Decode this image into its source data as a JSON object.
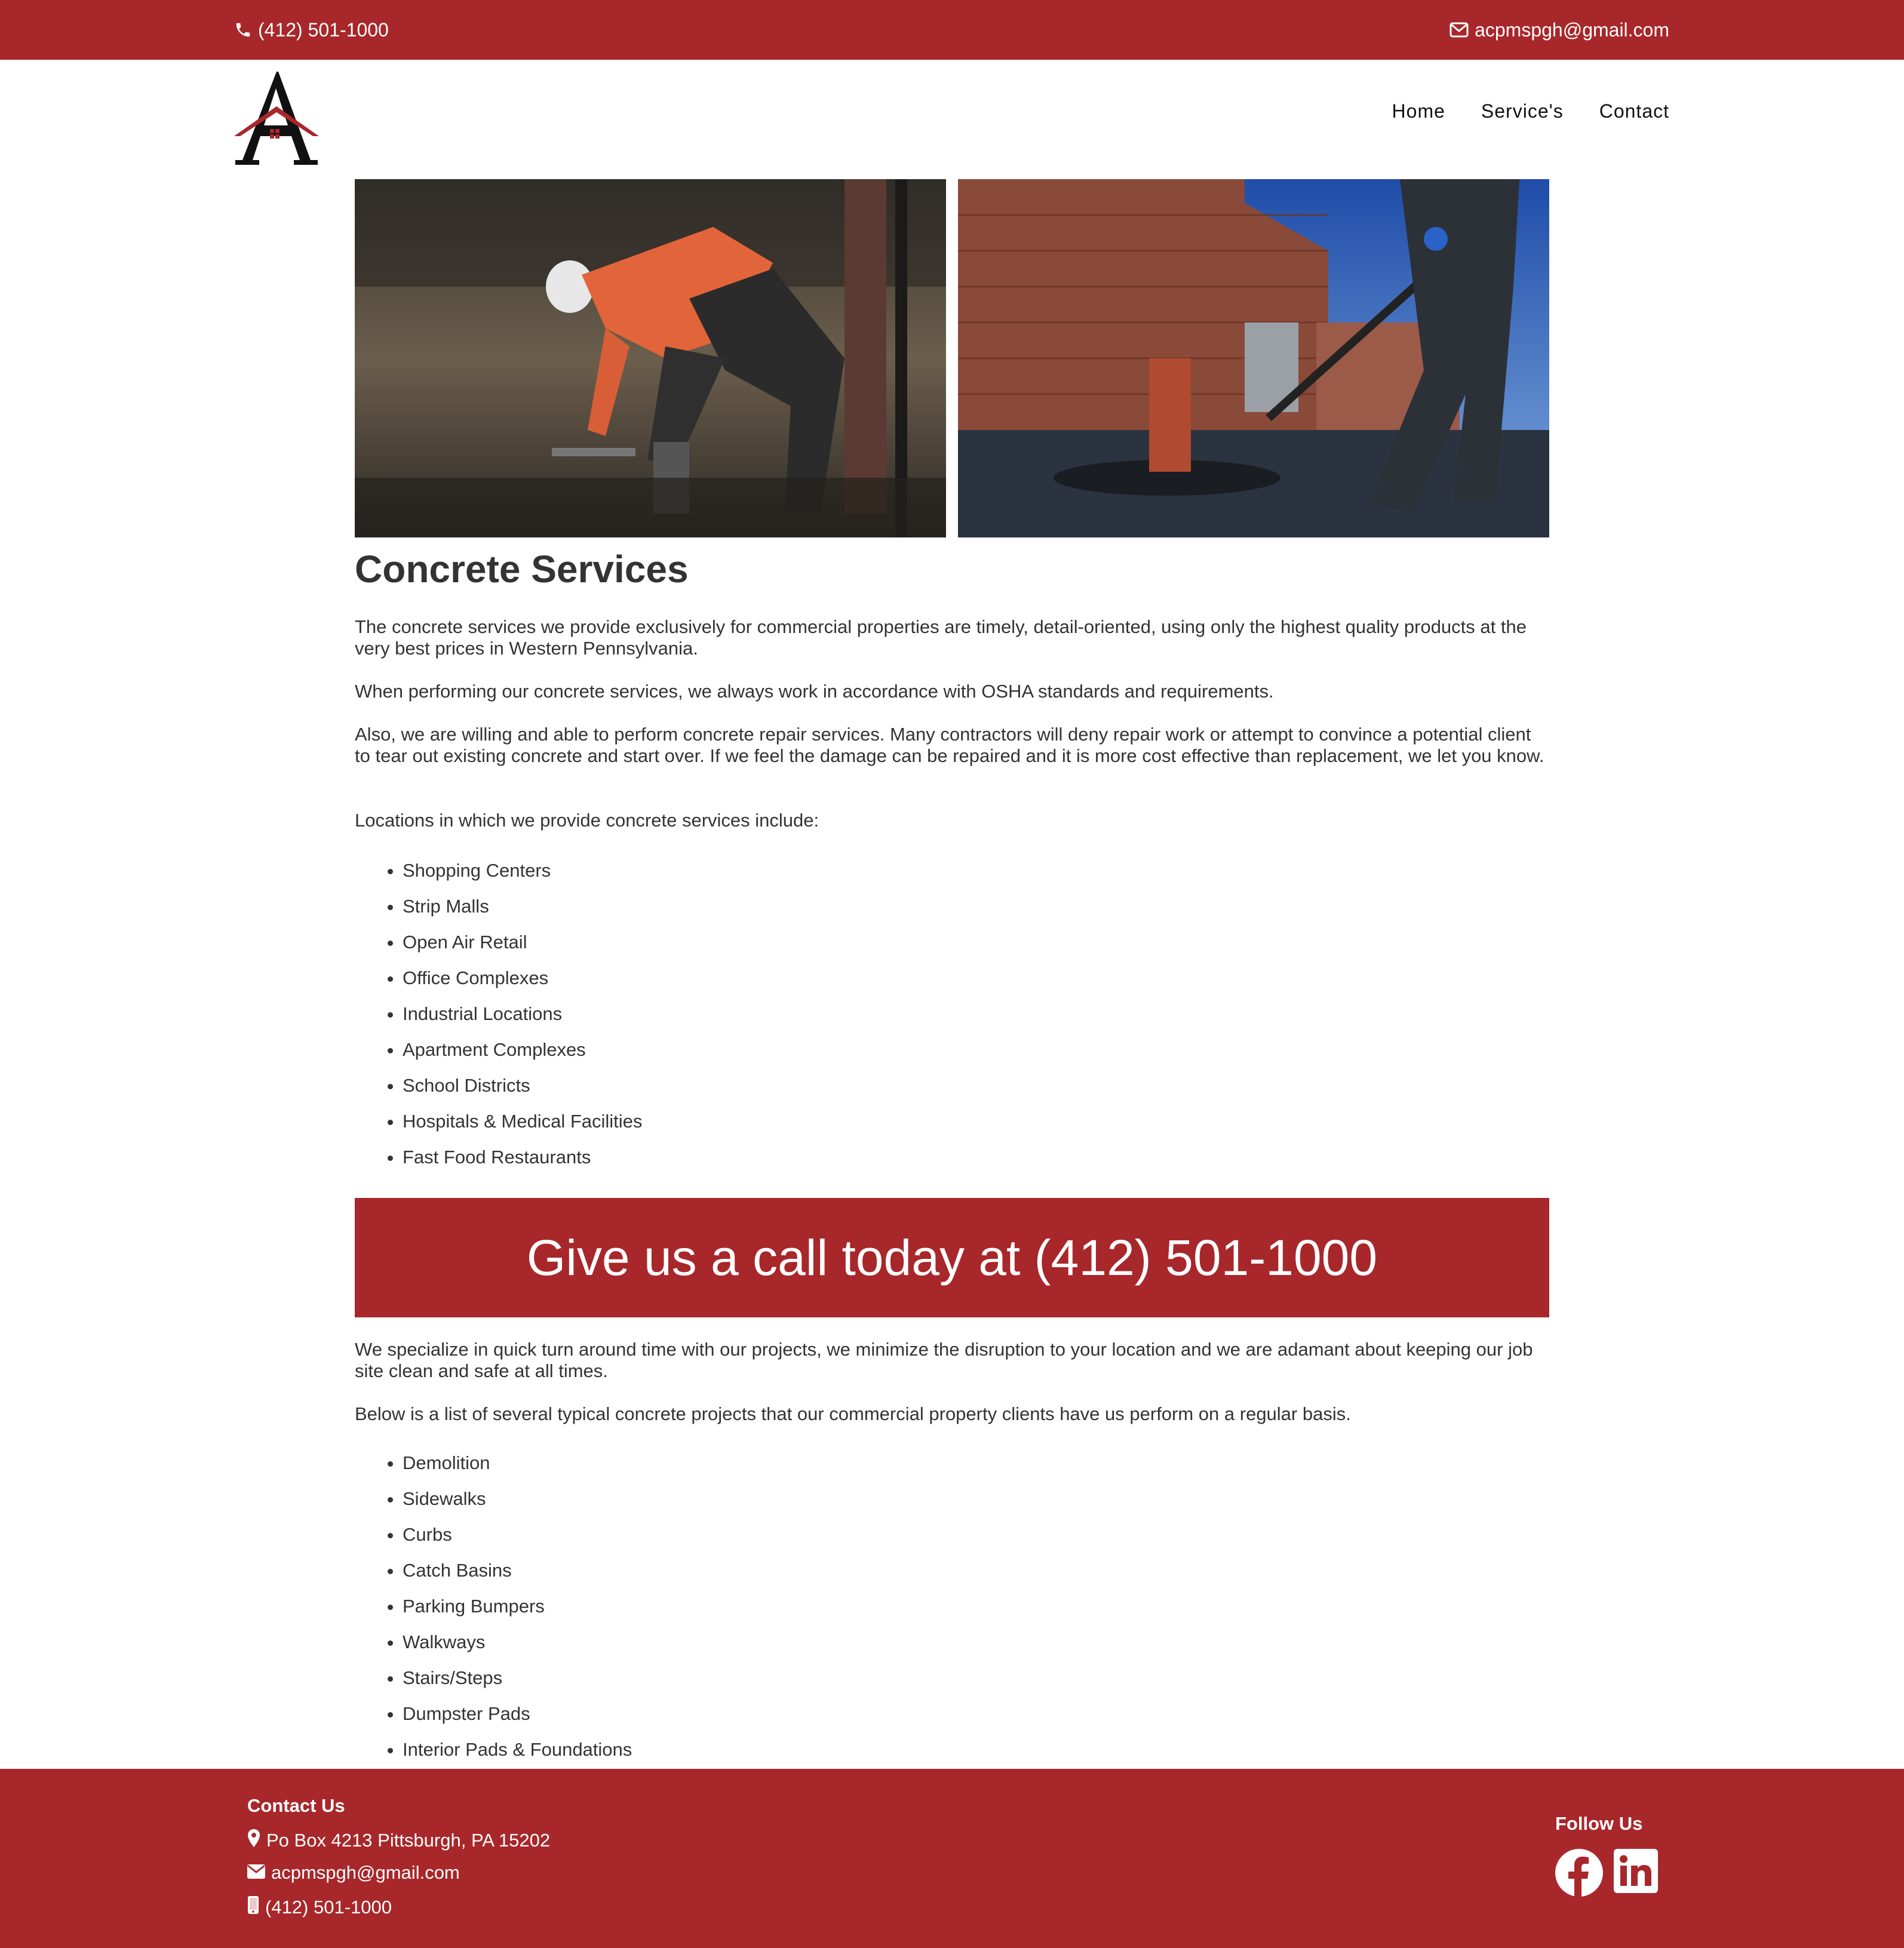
{
  "topbar": {
    "phone": "(412) 501-1000",
    "email": "acpmspgh@gmail.com"
  },
  "header": {
    "logo_alt": "A",
    "nav": [
      {
        "label": "Home"
      },
      {
        "label": "Service's"
      },
      {
        "label": "Contact"
      }
    ]
  },
  "main": {
    "title": "Concrete Services",
    "intro_paragraphs": [
      "The concrete services we provide exclusively for commercial properties are timely, detail-oriented, using only the highest quality products at the very best prices in Western Pennsylvania.",
      "When performing our concrete services, we always work in accordance with OSHA standards and requirements.",
      "Also, we are willing and able to perform concrete repair services. Many contractors will deny repair work or attempt to convince a potential client to tear out existing concrete and start over. If we feel the damage can be repaired and it is more cost effective than replacement, we let you know.",
      "Locations in which we provide concrete services include:"
    ],
    "locations": [
      "Shopping Centers",
      "Strip Malls",
      "Open Air Retail",
      "Office Complexes",
      "Industrial Locations",
      "Apartment Complexes",
      "School Districts",
      "Hospitals & Medical Facilities",
      "Fast Food Restaurants"
    ],
    "cta": "Give us a call today at (412) 501-1000",
    "after_paragraphs": [
      "We specialize in quick turn around time with our projects, we minimize the disruption to your location and we are adamant about keeping our job site clean and safe at all times.",
      "Below is a list of several typical concrete projects that our commercial property clients have us perform on a regular basis."
    ],
    "projects": [
      "Demolition",
      "Sidewalks",
      "Curbs",
      "Catch Basins",
      "Parking Bumpers",
      "Walkways",
      "Stairs/Steps",
      "Dumpster Pads",
      "Interior Pads & Foundations"
    ]
  },
  "footer": {
    "contact_heading": "Contact Us",
    "address": "Po Box 4213 Pittsburgh, PA 15202",
    "email": "acpmspgh@gmail.com",
    "phone": "(412) 501-1000",
    "follow_heading": "Follow Us"
  },
  "colors": {
    "brand_red": "#a8272a",
    "text": "#333333",
    "white": "#ffffff"
  },
  "icons": [
    "phone-icon",
    "envelope-icon",
    "map-marker-icon",
    "mobile-phone-icon",
    "facebook-icon",
    "linkedin-icon"
  ]
}
